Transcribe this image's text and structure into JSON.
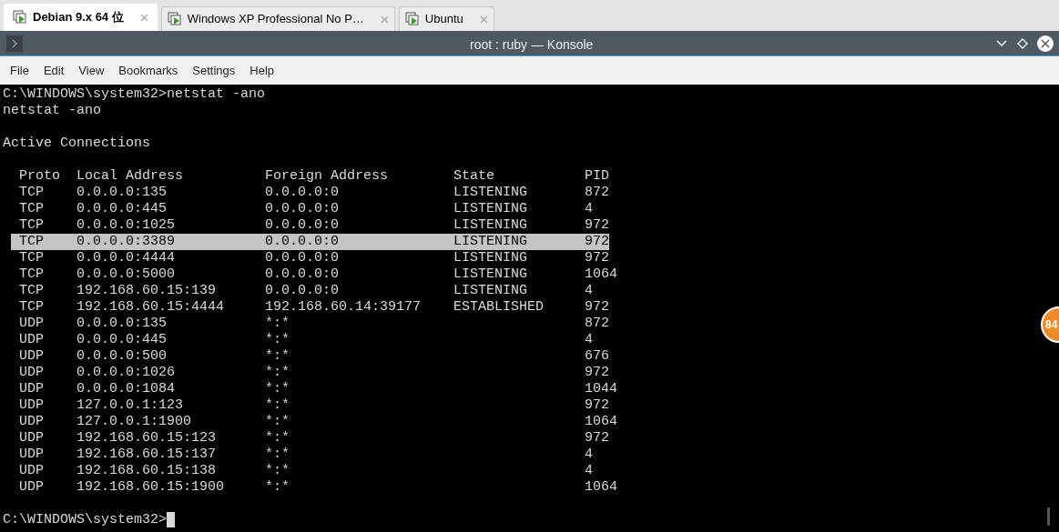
{
  "tabs": [
    {
      "label": "Debian 9.x 64 位",
      "selected": true
    },
    {
      "label": "Windows XP Professional No P…",
      "selected": false
    },
    {
      "label": "Ubuntu",
      "selected": false
    }
  ],
  "window": {
    "title": "root : ruby — Konsole"
  },
  "menu": [
    "File",
    "Edit",
    "View",
    "Bookmarks",
    "Settings",
    "Help"
  ],
  "terminal": {
    "command_line": "C:\\WINDOWS\\system32>netstat -ano",
    "echo_line": "netstat -ano",
    "heading": "Active Connections",
    "columns": [
      "Proto",
      "Local Address",
      "Foreign Address",
      "State",
      "PID"
    ],
    "rows": [
      {
        "cells": [
          "TCP",
          "0.0.0.0:135",
          "0.0.0.0:0",
          "LISTENING",
          "872"
        ],
        "selected": false
      },
      {
        "cells": [
          "TCP",
          "0.0.0.0:445",
          "0.0.0.0:0",
          "LISTENING",
          "4"
        ],
        "selected": false
      },
      {
        "cells": [
          "TCP",
          "0.0.0.0:1025",
          "0.0.0.0:0",
          "LISTENING",
          "972"
        ],
        "selected": false
      },
      {
        "cells": [
          "TCP",
          "0.0.0.0:3389",
          "0.0.0.0:0",
          "LISTENING",
          "972"
        ],
        "selected": true
      },
      {
        "cells": [
          "TCP",
          "0.0.0.0:4444",
          "0.0.0.0:0",
          "LISTENING",
          "972"
        ],
        "selected": false
      },
      {
        "cells": [
          "TCP",
          "0.0.0.0:5000",
          "0.0.0.0:0",
          "LISTENING",
          "1064"
        ],
        "selected": false
      },
      {
        "cells": [
          "TCP",
          "192.168.60.15:139",
          "0.0.0.0:0",
          "LISTENING",
          "4"
        ],
        "selected": false
      },
      {
        "cells": [
          "TCP",
          "192.168.60.15:4444",
          "192.168.60.14:39177",
          "ESTABLISHED",
          "972"
        ],
        "selected": false
      },
      {
        "cells": [
          "UDP",
          "0.0.0.0:135",
          "*:*",
          null,
          "872"
        ],
        "selected": false
      },
      {
        "cells": [
          "UDP",
          "0.0.0.0:445",
          "*:*",
          null,
          "4"
        ],
        "selected": false
      },
      {
        "cells": [
          "UDP",
          "0.0.0.0:500",
          "*:*",
          null,
          "676"
        ],
        "selected": false
      },
      {
        "cells": [
          "UDP",
          "0.0.0.0:1026",
          "*:*",
          null,
          "972"
        ],
        "selected": false
      },
      {
        "cells": [
          "UDP",
          "0.0.0.0:1084",
          "*:*",
          null,
          "1044"
        ],
        "selected": false
      },
      {
        "cells": [
          "UDP",
          "127.0.0.1:123",
          "*:*",
          null,
          "972"
        ],
        "selected": false
      },
      {
        "cells": [
          "UDP",
          "127.0.0.1:1900",
          "*:*",
          null,
          "1064"
        ],
        "selected": false
      },
      {
        "cells": [
          "UDP",
          "192.168.60.15:123",
          "*:*",
          null,
          "972"
        ],
        "selected": false
      },
      {
        "cells": [
          "UDP",
          "192.168.60.15:137",
          "*:*",
          null,
          "4"
        ],
        "selected": false
      },
      {
        "cells": [
          "UDP",
          "192.168.60.15:138",
          "*:*",
          null,
          "4"
        ],
        "selected": false
      },
      {
        "cells": [
          "UDP",
          "192.168.60.15:1900",
          "*:*",
          null,
          "1064"
        ],
        "selected": false
      }
    ],
    "prompt": "C:\\WINDOWS\\system32>"
  },
  "floating_badge": "84"
}
